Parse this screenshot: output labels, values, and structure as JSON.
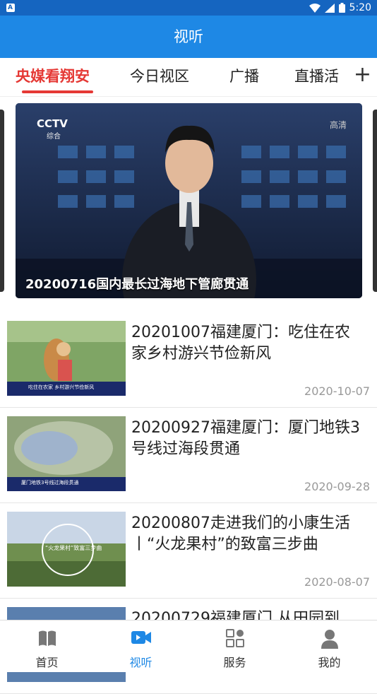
{
  "status_bar": {
    "time": "5:20",
    "notification_icon": "a-letter-icon"
  },
  "app_bar": {
    "title": "视听"
  },
  "tabs": [
    {
      "label": "央媒看翔安",
      "active": true
    },
    {
      "label": "今日视区",
      "active": false
    },
    {
      "label": "广播",
      "active": false
    },
    {
      "label": "直播活",
      "active": false
    }
  ],
  "tab_add_label": "+",
  "banner": {
    "caption": "20200716国内最长过海地下管廊贯通",
    "logo_text": "CCTV",
    "logo_sub": "综合",
    "hd_text": "高清"
  },
  "news": [
    {
      "title": "20201007福建厦门：吃住在农家乡村游兴节俭新风",
      "date": "2020-10-07",
      "thumb_caption": "吃住在农家 乡村游兴节俭新风"
    },
    {
      "title": "20200927福建厦门：厦门地铁3号线过海段贯通",
      "date": "2020-09-28",
      "thumb_caption": "厦门地铁3号线过海段贯通"
    },
    {
      "title": "20200807走进我们的小康生活丨“火龙果村”的致富三步曲",
      "date": "2020-08-07",
      "thumb_caption": "“火龙果村”致富三步曲"
    },
    {
      "title": "20200729福建厦门 从田园到",
      "date": "",
      "thumb_caption": ""
    }
  ],
  "bottom_nav": [
    {
      "label": "首页",
      "icon": "book-icon",
      "active": false
    },
    {
      "label": "视听",
      "icon": "video-camera-icon",
      "active": true
    },
    {
      "label": "服务",
      "icon": "grid-icon",
      "active": false
    },
    {
      "label": "我的",
      "icon": "person-icon",
      "active": false
    }
  ],
  "colors": {
    "primary": "#1e88e5",
    "status_bar": "#1565c0",
    "accent_red": "#e53935"
  }
}
